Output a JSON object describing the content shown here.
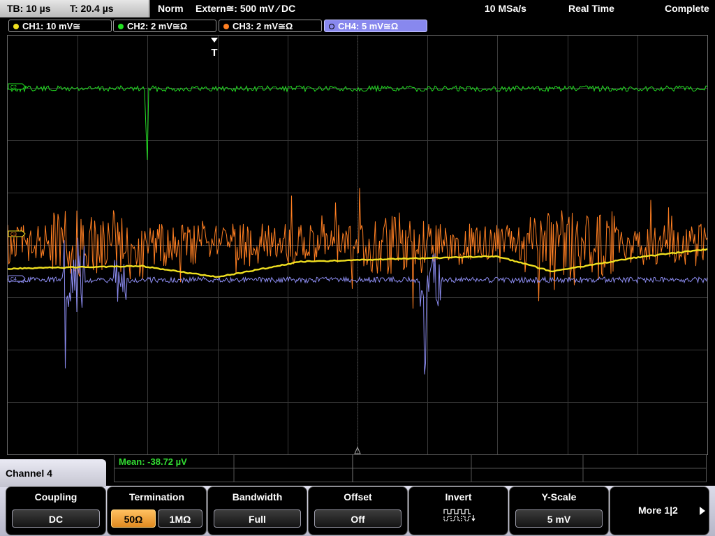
{
  "status_bar": {
    "timebase": "TB: 10 µs",
    "trigger_time": "T: 20.4 µs",
    "trigger_mode": "Norm",
    "trigger_source": "Extern≅: 500 mV ⁄ DC",
    "sample_rate": "10 MSa/s",
    "acquisition_mode": "Real Time",
    "acquisition_state": "Complete"
  },
  "channel_tabs": [
    {
      "label": "CH1: 10 mV≅",
      "color": "#f0e020"
    },
    {
      "label": "CH2: 2 mV≅Ω",
      "color": "#22e022"
    },
    {
      "label": "CH3: 2 mV≅Ω",
      "color": "#ff7f22"
    },
    {
      "label": "CH4: 5 mV≅Ω",
      "color": "#8c8cf0"
    }
  ],
  "trigger_marker": "T",
  "trace_labels": [
    "C2",
    "C3",
    "C4"
  ],
  "measurement": {
    "label": "Mean: -38.72 µV"
  },
  "menu": {
    "title": "Channel 4",
    "coupling": {
      "title": "Coupling",
      "value": "DC"
    },
    "termination": {
      "title": "Termination",
      "options": [
        "50Ω",
        "1MΩ"
      ],
      "selected": "50Ω"
    },
    "bandwidth": {
      "title": "Bandwidth",
      "value": "Full"
    },
    "offset": {
      "title": "Offset",
      "value": "Off"
    },
    "invert": {
      "title": "Invert",
      "icon": "invert-waveform-icon"
    },
    "yscale": {
      "title": "Y-Scale",
      "value": "5 mV"
    },
    "more": {
      "label": "More 1|2",
      "icon": "play-arrow-icon"
    }
  },
  "trace_colors": {
    "ch1": "#f0e020",
    "ch2": "#22e022",
    "ch3": "#ff7f22",
    "ch4": "#8c8cf0"
  }
}
